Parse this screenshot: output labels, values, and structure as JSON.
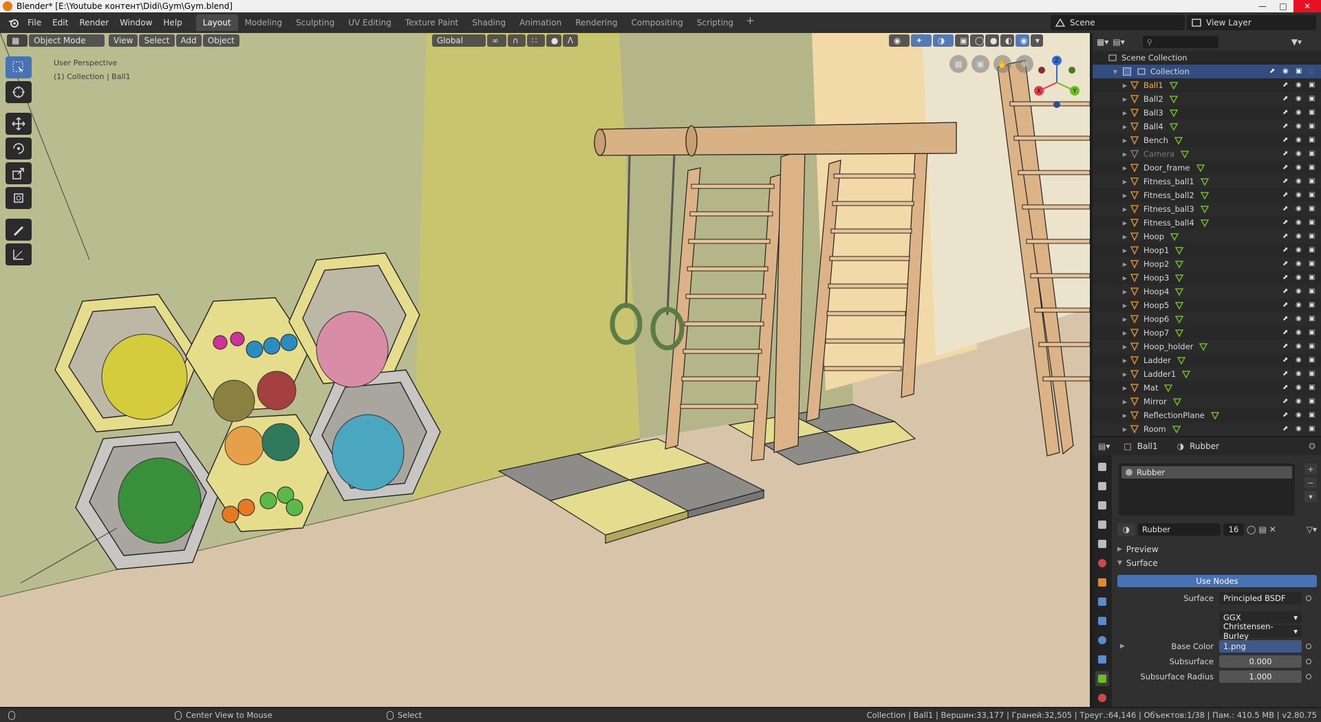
{
  "window": {
    "title": "Blender* [E:\\Youtube контент\\Didi\\Gym\\Gym.blend]"
  },
  "menu": [
    "File",
    "Edit",
    "Render",
    "Window",
    "Help"
  ],
  "workspaces": [
    "Layout",
    "Modeling",
    "Sculpting",
    "UV Editing",
    "Texture Paint",
    "Shading",
    "Animation",
    "Rendering",
    "Compositing",
    "Scripting"
  ],
  "active_workspace": "Layout",
  "scene": "Scene",
  "view_layer": "View Layer",
  "viewport": {
    "mode": "Object Mode",
    "menus": [
      "View",
      "Select",
      "Add",
      "Object"
    ],
    "orientation": "Global",
    "perspective": "User Perspective",
    "collection_info": "(1) Collection | Ball1",
    "gizmo_axes": [
      "X",
      "Y",
      "Z"
    ]
  },
  "outliner": {
    "root": "Scene Collection",
    "collection": "Collection",
    "items": [
      {
        "name": "Ball1",
        "active": true
      },
      {
        "name": "Ball2"
      },
      {
        "name": "Ball3"
      },
      {
        "name": "Ball4"
      },
      {
        "name": "Bench"
      },
      {
        "name": "Camera",
        "dim": true
      },
      {
        "name": "Door_frame"
      },
      {
        "name": "Fitness_ball1"
      },
      {
        "name": "Fitness_ball2"
      },
      {
        "name": "Fitness_ball3"
      },
      {
        "name": "Fitness_ball4"
      },
      {
        "name": "Hoop"
      },
      {
        "name": "Hoop1"
      },
      {
        "name": "Hoop2"
      },
      {
        "name": "Hoop3"
      },
      {
        "name": "Hoop4"
      },
      {
        "name": "Hoop5"
      },
      {
        "name": "Hoop6"
      },
      {
        "name": "Hoop7"
      },
      {
        "name": "Hoop_holder"
      },
      {
        "name": "Ladder"
      },
      {
        "name": "Ladder1"
      },
      {
        "name": "Mat"
      },
      {
        "name": "Mirror"
      },
      {
        "name": "ReflectionPlane"
      },
      {
        "name": "Room"
      }
    ]
  },
  "properties": {
    "object": "Ball1",
    "material": "Rubber",
    "slot": "Rubber",
    "users": "16",
    "panels": {
      "preview": "Preview",
      "surface": "Surface"
    },
    "use_nodes": "Use Nodes",
    "surface_label": "Surface",
    "surface_value": "Principled BSDF",
    "distribution": "GGX",
    "subsurface_method": "Christensen-Burley",
    "base_color_label": "Base Color",
    "base_color_value": "1.png",
    "subsurface_label": "Subsurface",
    "subsurface_value": "0.000",
    "subsurface_radius_label": "Subsurface Radius",
    "subsurface_radius_value": "1.000"
  },
  "status": {
    "center_view": "Center View to Mouse",
    "select": "Select",
    "stats": "Collection | Ball1 | Вершин:33,177 | Граней:32,505 | Треуг.:64,146 | Объектов:1/38 | Пам.: 410.5 MB | v2.80.75"
  },
  "colors": {
    "accent_blue": "#4772b3",
    "active_object": "#ffaf29",
    "selection_row": "#334d80",
    "header_bg": "#303030"
  }
}
